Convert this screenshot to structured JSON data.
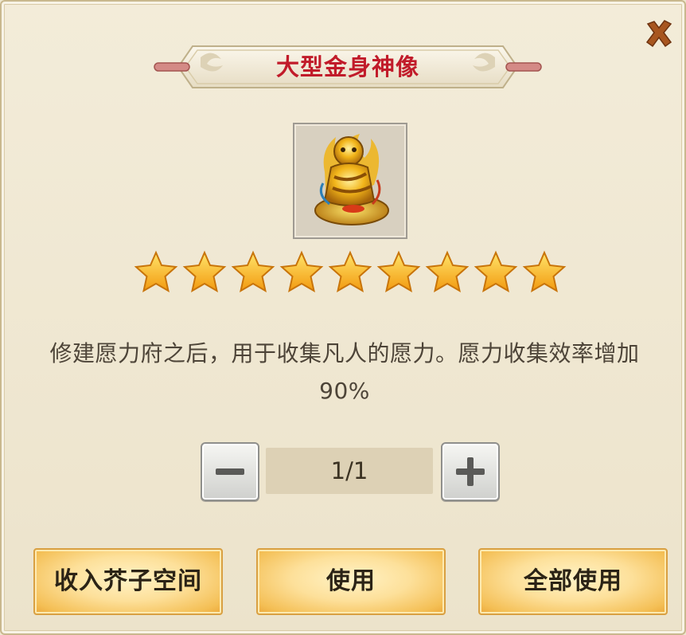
{
  "dialog": {
    "title": "大型金身神像",
    "item_icon": "golden-statue-icon",
    "star_rating": 9,
    "description": "修建愿力府之后，用于收集凡人的愿力。愿力收集效率增加90%",
    "close_icon": "close-icon"
  },
  "quantity": {
    "value": "1/1",
    "decrease_icon": "minus-icon",
    "increase_icon": "plus-icon"
  },
  "actions": {
    "store_label": "收入芥子空间",
    "use_label": "使用",
    "use_all_label": "全部使用"
  },
  "colors": {
    "title": "#c11b2a",
    "text": "#4d4438",
    "button_gold": "#f4bf55",
    "background": "#efe7d0"
  }
}
